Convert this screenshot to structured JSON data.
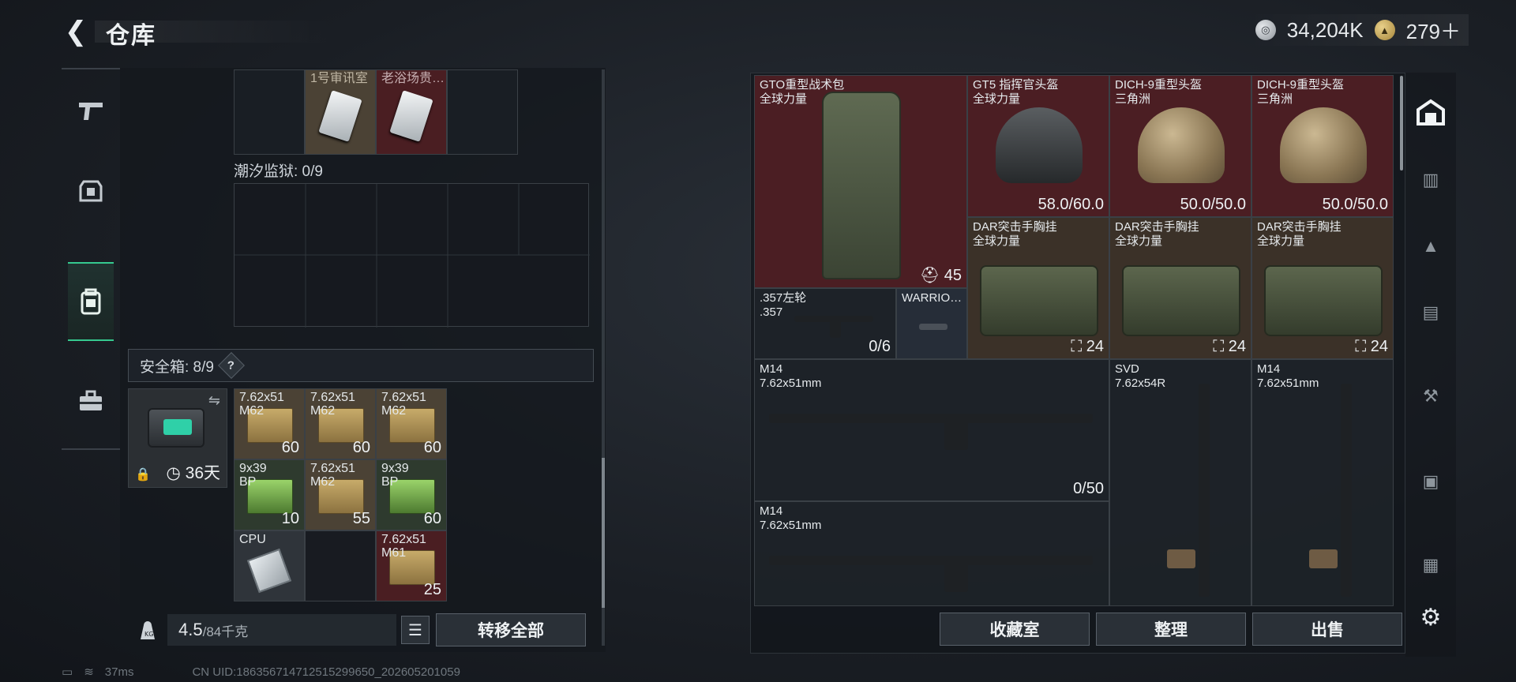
{
  "header": {
    "title": "仓库",
    "currency_silver": "34,204K",
    "currency_gold": "279＋"
  },
  "left": {
    "top_items": [
      {
        "label": "1号审讯室"
      },
      {
        "label": "老浴场贵…"
      }
    ],
    "prison_label": "潮汐监狱: 0/9",
    "safebox_label": "安全箱:  8/9",
    "safebox_help": "?",
    "safebox_days": "36天",
    "safe_items": [
      {
        "label": "7.62x51\nM62",
        "qty": "60",
        "kind": "ammo"
      },
      {
        "label": "7.62x51\nM62",
        "qty": "60",
        "kind": "ammo"
      },
      {
        "label": "7.62x51\nM62",
        "qty": "60",
        "kind": "ammo"
      },
      {
        "label": "9x39\nBP",
        "qty": "10",
        "kind": "ammo-green"
      },
      {
        "label": "7.62x51\nM62",
        "qty": "55",
        "kind": "ammo"
      },
      {
        "label": "9x39\nBP",
        "qty": "60",
        "kind": "ammo-green"
      },
      {
        "label": "CPU",
        "qty": "",
        "kind": "chip"
      },
      {
        "label": "",
        "qty": "",
        "kind": "empty"
      },
      {
        "label": "7.62x51\nM61",
        "qty": "25",
        "kind": "ammo"
      }
    ],
    "weight_current": "4.5",
    "weight_max": "/84千克",
    "transfer_all": "转移全部"
  },
  "right": {
    "items": [
      {
        "label": "GTO重型战术包\n全球力量",
        "qty": "45"
      },
      {
        "label": "GT5 指挥官头盔\n全球力量",
        "qty": "58.0/60.0"
      },
      {
        "label": "DICH-9重型头盔\n三角洲",
        "qty": "50.0/50.0"
      },
      {
        "label": "DICH-9重型头盔\n三角洲",
        "qty": "50.0/50.0"
      },
      {
        "label": "DAR突击手胸挂\n全球力量",
        "qty": "24"
      },
      {
        "label": "DAR突击手胸挂\n全球力量",
        "qty": "24"
      },
      {
        "label": "DAR突击手胸挂\n全球力量",
        "qty": "24"
      },
      {
        "label": ".357左轮\n.357",
        "qty": "0/6"
      },
      {
        "label": "WARRIO…",
        "qty": ""
      },
      {
        "label": "M14\n7.62x51mm",
        "qty": "0/50"
      },
      {
        "label": "SVD\n7.62x54R",
        "qty": ""
      },
      {
        "label": "M14\n7.62x51mm",
        "qty": ""
      },
      {
        "label": "M14\n7.62x51mm",
        "qty": ""
      }
    ],
    "buttons": [
      "收藏室",
      "整理",
      "出售"
    ]
  },
  "status": {
    "ping": "37ms",
    "uid": "CN UID:18635671471251529965​0_202605201059"
  },
  "icons": {
    "back": "back-arrow-icon",
    "weapon_tab": "pistol-icon",
    "gear_tab": "armor-icon",
    "storage_tab": "backpack-icon",
    "case_tab": "briefcase-icon",
    "settings": "gear-icon"
  }
}
